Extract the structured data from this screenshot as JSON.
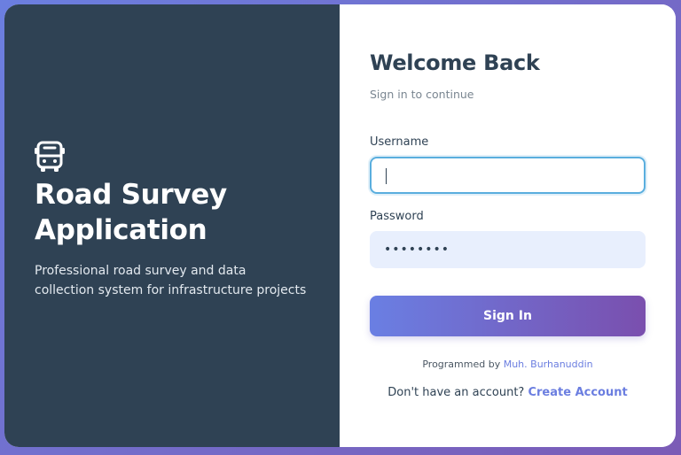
{
  "left_panel": {
    "title": "Road Survey Application",
    "description": "Professional road survey and data collection system for infrastructure projects",
    "icon": "bus-icon",
    "background_color": "#2f4254"
  },
  "form": {
    "heading": "Welcome Back",
    "subtitle": "Sign in to continue",
    "username_label": "Username",
    "username_value": "",
    "password_label": "Password",
    "password_value": "••••••••",
    "submit_label": "Sign In",
    "credit_prefix": "Programmed by",
    "credit_name": "Muh. Burhanuddin",
    "signup_prefix": "Don't have an account?",
    "signup_link": "Create Account"
  },
  "colors": {
    "accent": "#6b7ee0",
    "accent_end": "#7a4fae",
    "focus_border": "#5aaede",
    "password_bg": "#e8effd"
  }
}
